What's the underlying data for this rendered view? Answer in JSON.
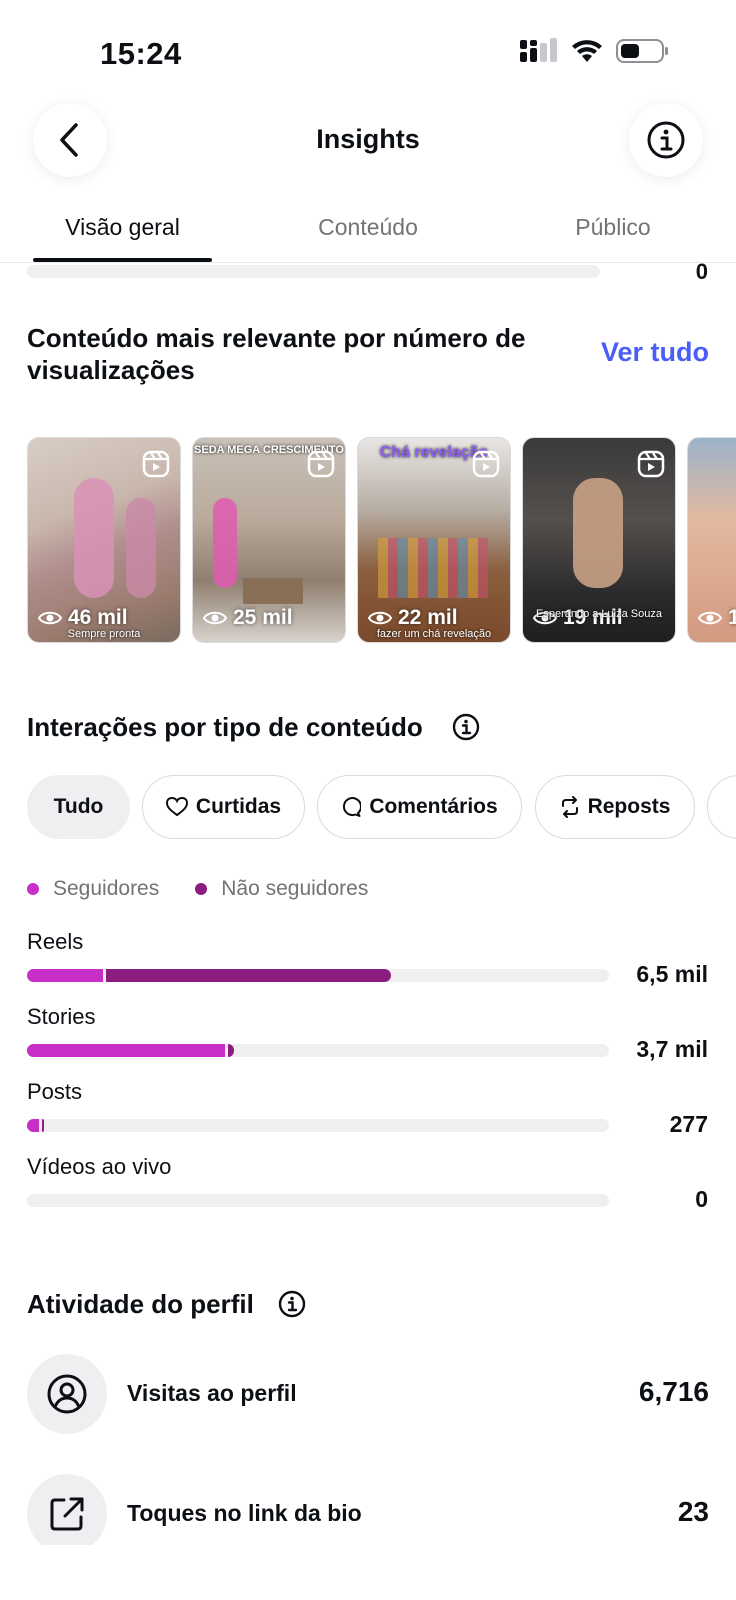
{
  "status_bar": {
    "time": "15:24"
  },
  "header": {
    "title": "Insights"
  },
  "tabs": [
    {
      "label": "Visão geral",
      "active": true
    },
    {
      "label": "Conteúdo",
      "active": false
    },
    {
      "label": "Público",
      "active": false
    }
  ],
  "top_partial_row": {
    "value": "0"
  },
  "top_content": {
    "title": "Conteúdo mais relevante por número de visualizações",
    "see_all": "Ver tudo",
    "items": [
      {
        "views": "46 mil",
        "caption": "Sempre pronta"
      },
      {
        "views": "25 mil",
        "overlay_text": "SEDA MEGA CRESCIMENTO"
      },
      {
        "views": "22 mil",
        "overlay_text": "Chá revelação",
        "caption": "fazer um chá revelação"
      },
      {
        "views": "19 mil",
        "caption": "Esperando a Luiza Souza"
      },
      {
        "views": "1"
      }
    ]
  },
  "interactions": {
    "title": "Interações por tipo de conteúdo",
    "filters": [
      {
        "label": "Tudo",
        "icon": "",
        "selected": true
      },
      {
        "label": "Curtidas",
        "icon": "heart-icon",
        "selected": false
      },
      {
        "label": "Comentários",
        "icon": "comment-icon",
        "selected": false
      },
      {
        "label": "Reposts",
        "icon": "repost-icon",
        "selected": false
      }
    ],
    "legend": [
      {
        "label": "Seguidores",
        "color": "#c72fc8"
      },
      {
        "label": "Não seguidores",
        "color": "#8c1d80"
      }
    ],
    "rows": [
      {
        "label": "Reels",
        "value": "6,5 mil",
        "followers_fraction": 0.13,
        "nonfollowers_fraction": 0.49
      },
      {
        "label": "Stories",
        "value": "3,7 mil",
        "followers_fraction": 0.34,
        "nonfollowers_fraction": 0.01
      },
      {
        "label": "Posts",
        "value": "277",
        "followers_fraction": 0.02,
        "nonfollowers_fraction": 0.003
      },
      {
        "label": "Vídeos ao vivo",
        "value": "0",
        "followers_fraction": 0,
        "nonfollowers_fraction": 0
      }
    ]
  },
  "profile_activity": {
    "title": "Atividade do perfil",
    "rows": [
      {
        "label": "Visitas ao perfil",
        "value": "6,716",
        "icon": "profile-icon"
      },
      {
        "label": "Toques no link da bio",
        "value": "23",
        "icon": "external-link-icon"
      }
    ]
  }
}
